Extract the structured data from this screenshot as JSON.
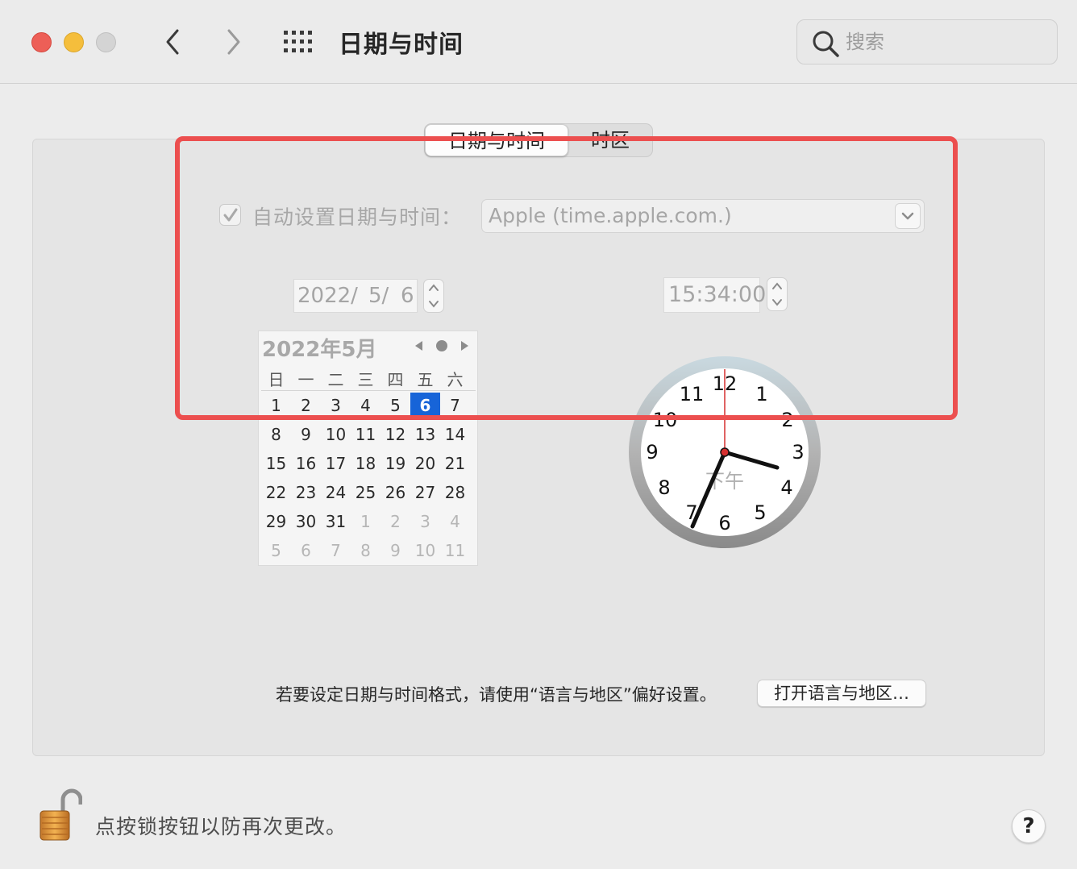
{
  "window": {
    "title": "日期与时间"
  },
  "search": {
    "placeholder": "搜索"
  },
  "tabs": [
    {
      "label": "日期与时间",
      "active": true
    },
    {
      "label": "时区",
      "active": false
    }
  ],
  "auto_set": {
    "label": "自动设置日期与时间：",
    "checked": true,
    "server": "Apple (time.apple.com.)"
  },
  "date_field": {
    "year": "2022/",
    "month": "5/",
    "day": "6"
  },
  "time_field": {
    "value": "15:34:00"
  },
  "calendar": {
    "title": "2022年5月",
    "weekdays": [
      "日",
      "一",
      "二",
      "三",
      "四",
      "五",
      "六"
    ],
    "weeks": [
      [
        "1",
        "2",
        "3",
        "4",
        "5",
        "6",
        "7"
      ],
      [
        "8",
        "9",
        "10",
        "11",
        "12",
        "13",
        "14"
      ],
      [
        "15",
        "16",
        "17",
        "18",
        "19",
        "20",
        "21"
      ],
      [
        "22",
        "23",
        "24",
        "25",
        "26",
        "27",
        "28"
      ],
      [
        "29",
        "30",
        "31",
        "1",
        "2",
        "3",
        "4"
      ],
      [
        "5",
        "6",
        "7",
        "8",
        "9",
        "10",
        "11"
      ]
    ],
    "selected": "6"
  },
  "clock": {
    "numbers": [
      "12",
      "1",
      "2",
      "3",
      "4",
      "5",
      "6",
      "7",
      "8",
      "9",
      "10",
      "11"
    ],
    "period": "下午"
  },
  "footer": {
    "format_hint": "若要设定日期与时间格式，请使用“语言与地区”偏好设置。",
    "open_region_button": "打开语言与地区…",
    "lock_text": "点按锁按钮以防再次更改。",
    "help_label": "?"
  },
  "icons": {
    "back": "chevron-left-icon",
    "forward": "chevron-right-icon",
    "grid": "grid-icon",
    "search": "search-icon",
    "lock": "lock-open-icon"
  },
  "colors": {
    "highlight": "#ec4f4f",
    "selection": "#1764d8",
    "close": "#ed5f57",
    "minimize": "#f5be3c"
  }
}
